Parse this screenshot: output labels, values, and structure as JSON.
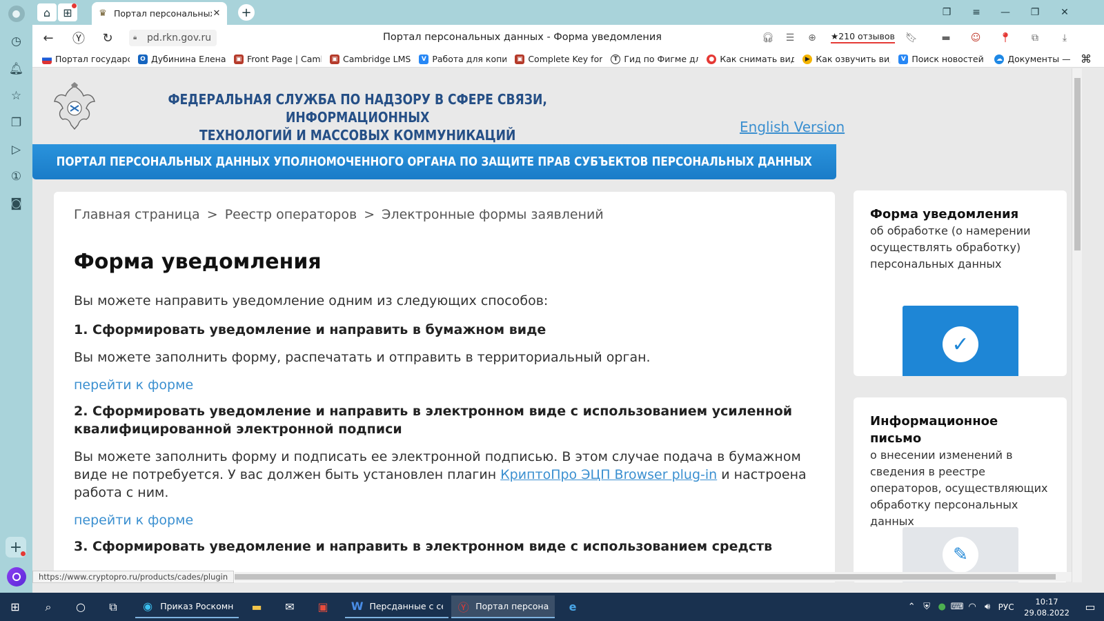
{
  "browser": {
    "tab_title": "Портал персональных данных - Форма уведомления",
    "tab_title_short": "Портал персональных д",
    "address": "pd.rkn.gov.ru",
    "page_title": "Портал персональных данных - Форма уведомления",
    "reviews": "★210 отзывов",
    "status_url": "https://www.cryptopro.ru/products/cades/plugin"
  },
  "bookmarks": [
    {
      "label": "Портал государст",
      "color": "#d33"
    },
    {
      "label": "Дубинина Елена Е",
      "color": "#1565c0"
    },
    {
      "label": "Front Page | Camb",
      "color": "#b53b2b"
    },
    {
      "label": "Cambridge LMS",
      "color": "#b53b2b"
    },
    {
      "label": "Работа для копир",
      "color": "#2787f5"
    },
    {
      "label": "Complete Key for",
      "color": "#b53b2b"
    },
    {
      "label": "Гид по Фигме для",
      "color": "#333"
    },
    {
      "label": "Как снимать виде",
      "color": "#e53935"
    },
    {
      "label": "Как озвучить виде",
      "color": "#f4b400"
    },
    {
      "label": "Поиск новостей п",
      "color": "#2787f5"
    },
    {
      "label": "Документы —",
      "color": "#1e88e5"
    }
  ],
  "site": {
    "org_line1": "ФЕДЕРАЛЬНАЯ СЛУЖБА ПО НАДЗОРУ В СФЕРЕ СВЯЗИ, ИНФОРМАЦИОННЫХ",
    "org_line2": "ТЕХНОЛОГИЙ И МАССОВЫХ КОММУНИКАЦИЙ",
    "english_link": "English Version",
    "banner": "ПОРТАЛ ПЕРСОНАЛЬНЫХ ДАННЫХ УПОЛНОМОЧЕННОГО ОРГАНА ПО ЗАЩИТЕ ПРАВ СУБЪЕКТОВ ПЕРСОНАЛЬНЫХ ДАННЫХ"
  },
  "breadcrumb": [
    "Главная страница",
    "Реестр операторов",
    "Электронные формы заявлений"
  ],
  "breadcrumb_sep": ">",
  "content": {
    "heading": "Форма уведомления",
    "intro": "Вы можете направить уведомление одним из следующих способов:",
    "s1_title": "1. Сформировать уведомление и направить в бумажном виде",
    "s1_text": "Вы можете заполнить форму, распечатать и отправить в территориальный орган.",
    "s1_link": "перейти к форме",
    "s2_title": "2. Сформировать уведомление и направить в электронном виде с использованием усиленной квалифицированной электронной подписи",
    "s2_text_a": "Вы можете заполнить форму и подписать ее электронной подписью. В этом случае подача в бумажном виде не потребуется. У вас должен быть установлен плагин ",
    "s2_plugin_link": "КриптоПро ЭЦП Browser plug-in",
    "s2_text_b": " и настроена работа с ним.",
    "s2_link": "перейти к форме",
    "s3_title": "3. Сформировать уведомление и направить в электронном виде с использованием средств"
  },
  "side_cards": [
    {
      "title": "Форма уведомления",
      "text": "об обработке (о намерении осуществлять обработку) персональных данных"
    },
    {
      "title": "Информационное письмо",
      "text": "о внесении изменений в сведения в реестре операторов, осуществляющих обработку персональных данных"
    }
  ],
  "taskbar": {
    "apps": [
      {
        "label": "Приказ Роскомна..."
      },
      {
        "label": "Персданные с сен..."
      },
      {
        "label": "Портал персональ..."
      }
    ],
    "lang": "РУС",
    "time": "10:17",
    "date": "29.08.2022"
  }
}
